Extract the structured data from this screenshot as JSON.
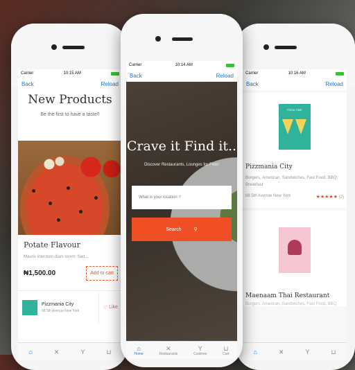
{
  "left_phone": {
    "status": {
      "carrier": "Carrier",
      "time": "10:15 AM"
    },
    "nav": {
      "back": "Back",
      "reload": "Reload"
    },
    "title": "New Products",
    "subtitle": "Be the first to have a taste!!",
    "product": {
      "name": "Potate Flavour",
      "description": "Mauris interdum diam lorem. Sed...",
      "price": "₦1,500.00",
      "add_to_cart": "Add to cart"
    },
    "restaurant": {
      "name": "Pizzmania City",
      "address": "68 5th Avenue New York",
      "like": "Like"
    }
  },
  "center_phone": {
    "status": {
      "carrier": "Carrier",
      "time": "10:14 AM"
    },
    "nav": {
      "back": "Back",
      "reload": "Reload"
    },
    "headline": "Crave it Find it..",
    "tagline": "Discover Restaurants, Lounges for Free!",
    "location_placeholder": "What is your location ?",
    "search_label": "Search",
    "tabs": [
      {
        "label": "Home",
        "icon": "home-icon"
      },
      {
        "label": "Restaurants",
        "icon": "cutlery-icon"
      },
      {
        "label": "Cuisines",
        "icon": "cocktail-icon"
      },
      {
        "label": "Cart",
        "icon": "cart-icon"
      }
    ]
  },
  "right_phone": {
    "status": {
      "carrier": "Carrier",
      "time": "10:16 AM"
    },
    "nav": {
      "back": "Back",
      "reload": "Reload"
    },
    "restaurants": [
      {
        "name": "Pizzmania City",
        "logo_text": "PIZZA TIME",
        "tags": "Burgers, American, Sandwiches, Fast Food, BBQ, Breakfast",
        "address": "68 5th Avenue New York",
        "rating_text": "(2)",
        "stars": "★★★★★"
      },
      {
        "name": "Maenaam Thai Restaurant",
        "tags": "Burgers, American, Sandwiches, Fast Food, BBQ"
      }
    ]
  },
  "colors": {
    "accent": "#f04e24",
    "link": "#1976d2",
    "teal": "#2fb39a"
  }
}
